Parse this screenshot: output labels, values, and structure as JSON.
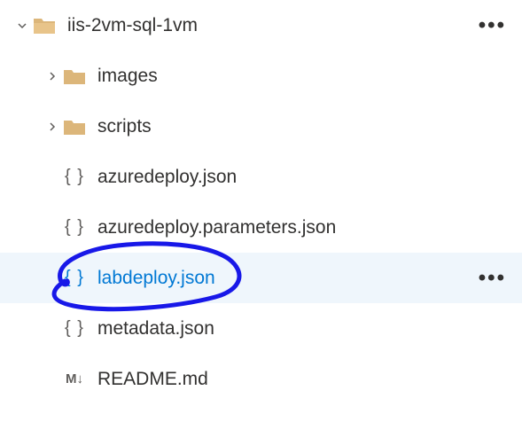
{
  "tree": {
    "root": {
      "label": "iis-2vm-sql-1vm",
      "expanded": true
    },
    "items": [
      {
        "label": "images",
        "type": "folder",
        "expanded": false
      },
      {
        "label": "scripts",
        "type": "folder",
        "expanded": false
      },
      {
        "label": "azuredeploy.json",
        "type": "json"
      },
      {
        "label": "azuredeploy.parameters.json",
        "type": "json"
      },
      {
        "label": "labdeploy.json",
        "type": "json",
        "selected": true
      },
      {
        "label": "metadata.json",
        "type": "json"
      },
      {
        "label": "README.md",
        "type": "md"
      }
    ]
  },
  "icons": {
    "json_braces": "{ }",
    "md_glyph": "M↓",
    "more": "•••"
  },
  "colors": {
    "folder": "#dcb67a",
    "text": "#323130",
    "selected_text": "#0078d4",
    "selected_bg": "#eff6fc",
    "annotation": "#1818e8"
  }
}
